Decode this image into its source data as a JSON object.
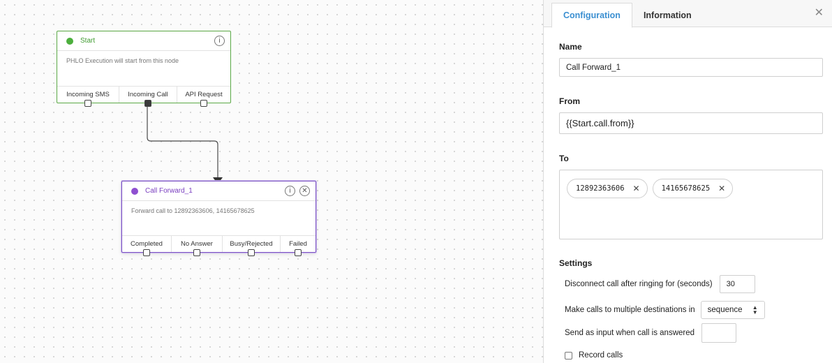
{
  "canvas": {
    "start_node": {
      "title": "Start",
      "description": "PHLO Execution will start from this node",
      "ports": [
        "Incoming SMS",
        "Incoming Call",
        "API Request"
      ]
    },
    "forward_node": {
      "title": "Call Forward_1",
      "description": "Forward call to 12892363606, 14165678625",
      "ports": [
        "Completed",
        "No Answer",
        "Busy/Rejected",
        "Failed"
      ]
    }
  },
  "panel": {
    "tabs": [
      "Configuration",
      "Information"
    ],
    "active_tab": "Configuration",
    "name_label": "Name",
    "name_value": "Call Forward_1",
    "from_label": "From",
    "from_value": "{{Start.call.from}}",
    "to_label": "To",
    "to_numbers": [
      "12892363606",
      "14165678625"
    ],
    "settings_label": "Settings",
    "ring_label": "Disconnect call after ringing for (seconds)",
    "ring_value": "30",
    "multi_label": "Make calls to multiple destinations in",
    "multi_value": "sequence",
    "input_label": "Send as input when call is answered",
    "input_value": "",
    "record_label": "Record calls"
  },
  "colors": {
    "start_accent": "#4caf3d",
    "forward_accent": "#8e4fd0",
    "tab_active": "#3b8fd1"
  },
  "icons": {
    "info": "info-icon",
    "close": "close-icon",
    "chip_remove": "remove-icon",
    "select_arrows": "sort-arrows-icon"
  }
}
